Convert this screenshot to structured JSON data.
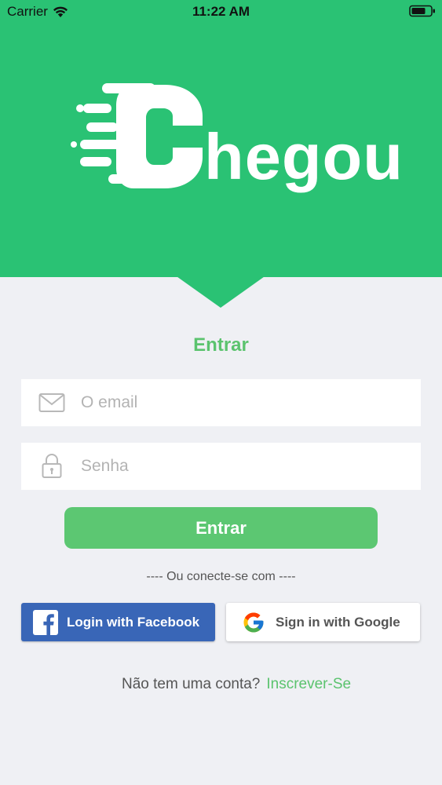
{
  "status_bar": {
    "carrier": "Carrier",
    "time": "11:22 AM"
  },
  "header": {
    "brand_text": "hegou",
    "background_color": "#2ac274"
  },
  "login_form": {
    "title": "Entrar",
    "email": {
      "placeholder": "O email",
      "value": "",
      "icon": "envelope-icon"
    },
    "password": {
      "placeholder": "Senha",
      "value": "",
      "icon": "lock-icon"
    },
    "submit_label": "Entrar"
  },
  "social": {
    "divider_text": "---- Ou conecte-se com ----",
    "facebook_label": "Login with Facebook",
    "google_label": "Sign in with Google"
  },
  "signup": {
    "prompt": "Não tem uma conta?",
    "link_label": "Inscrever-Se"
  },
  "colors": {
    "brand_green": "#2ac274",
    "accent_green": "#5bc36e",
    "facebook_blue": "#3966b7",
    "background": "#eff0f4"
  }
}
